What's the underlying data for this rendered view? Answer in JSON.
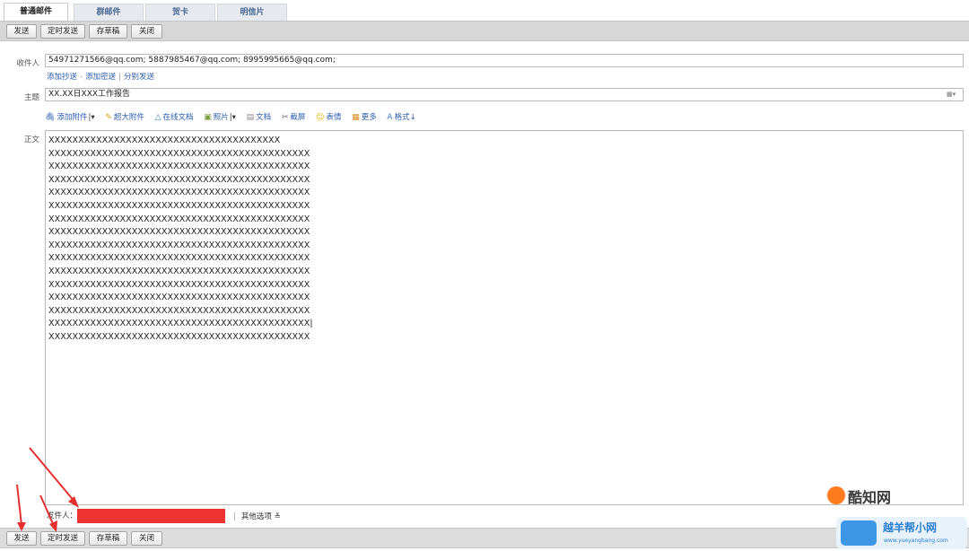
{
  "tabs": [
    "普通邮件",
    "群邮件",
    "贺卡",
    "明信片"
  ],
  "toolbar": {
    "send": "发送",
    "scheduled_send": "定时发送",
    "save_draft": "存草稿",
    "close": "关闭"
  },
  "recipients": {
    "label": "收件人",
    "value": "54971271566@qq.com; 5887985467@qq.com; 8995995665@qq.com;"
  },
  "recipient_links": {
    "add_cc": "添加抄送",
    "add_bcc": "添加密送",
    "separate_send": "分别发送"
  },
  "subject": {
    "label": "主题",
    "value": "XX.XX日XXX工作报告"
  },
  "editor_toolbar": {
    "add_attachment": "添加附件",
    "large_attachment": "超大附件",
    "online_doc": "在线文档",
    "photo": "照片",
    "document": "文档",
    "screenshot": "截屏",
    "emoji": "表情",
    "more": "更多",
    "format": "格式"
  },
  "body": {
    "label": "正文",
    "lines": [
      "XXXXXXXXXXXXXXXXXXXXXXXXXXXXXXXXXXXXXXX",
      "XXXXXXXXXXXXXXXXXXXXXXXXXXXXXXXXXXXXXXXXXXXX",
      "XXXXXXXXXXXXXXXXXXXXXXXXXXXXXXXXXXXXXXXXXXXX",
      "XXXXXXXXXXXXXXXXXXXXXXXXXXXXXXXXXXXXXXXXXXXX",
      "XXXXXXXXXXXXXXXXXXXXXXXXXXXXXXXXXXXXXXXXXXXX",
      "XXXXXXXXXXXXXXXXXXXXXXXXXXXXXXXXXXXXXXXXXXXX",
      "XXXXXXXXXXXXXXXXXXXXXXXXXXXXXXXXXXXXXXXXXXXX",
      "XXXXXXXXXXXXXXXXXXXXXXXXXXXXXXXXXXXXXXXXXXXX",
      "XXXXXXXXXXXXXXXXXXXXXXXXXXXXXXXXXXXXXXXXXXXX",
      "XXXXXXXXXXXXXXXXXXXXXXXXXXXXXXXXXXXXXXXXXXXX",
      "XXXXXXXXXXXXXXXXXXXXXXXXXXXXXXXXXXXXXXXXXXXX",
      "XXXXXXXXXXXXXXXXXXXXXXXXXXXXXXXXXXXXXXXXXXXX",
      "XXXXXXXXXXXXXXXXXXXXXXXXXXXXXXXXXXXXXXXXXXXX",
      "XXXXXXXXXXXXXXXXXXXXXXXXXXXXXXXXXXXXXXXXXXXX",
      "XXXXXXXXXXXXXXXXXXXXXXXXXXXXXXXXXXXXXXXXXXXX|",
      "XXXXXXXXXXXXXXXXXXXXXXXXXXXXXXXXXXXXXXXXXXXX"
    ]
  },
  "sender": {
    "label": "发件人：",
    "other_options": "其他选项"
  },
  "watermark": {
    "site1": "酷知网",
    "site2": "越羊帮小网",
    "site2_url": "www.yueyangbang.com"
  },
  "colors": {
    "redaction": "#ee3333",
    "arrow": "#e53030",
    "link": "#2a5db0"
  }
}
